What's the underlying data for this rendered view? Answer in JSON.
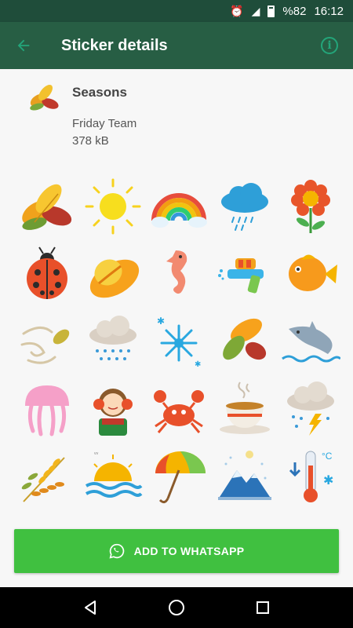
{
  "status_bar": {
    "alarm_icon": "alarm-icon",
    "signal_icon": "no-signal-icon",
    "battery": "%82",
    "time": "16:12"
  },
  "app_bar": {
    "title": "Sticker details",
    "back_icon": "arrow-back-icon",
    "info_icon": "info-icon"
  },
  "pack": {
    "name": "Seasons",
    "author": "Friday Team",
    "size": "378 kB",
    "tray_icon": "autumn-leaves-icon"
  },
  "stickers": [
    "autumn-leaves",
    "sun",
    "rainbow-cloud",
    "rain-cloud",
    "flower",
    "ladybug",
    "straw-hat",
    "seahorse",
    "water-gun",
    "fish",
    "wind-leaf",
    "rain-cloud-2",
    "snowflakes",
    "autumn-leaf-bunch",
    "dolphin",
    "jellyfish",
    "girl-earmuffs",
    "crab",
    "coffee-cup",
    "thunder-cloud",
    "wheat",
    "sunset-sea",
    "umbrella",
    "snowy-mountain",
    "thermometer"
  ],
  "add_button": {
    "label": "ADD TO WHATSAPP",
    "icon": "whatsapp-icon"
  },
  "nav": {
    "back": "nav-back-icon",
    "home": "nav-home-icon",
    "recents": "nav-recents-icon"
  },
  "colors": {
    "status_bar": "#1f4d3a",
    "app_bar": "#275e44",
    "accent": "#23a57a",
    "button": "#40c040"
  }
}
